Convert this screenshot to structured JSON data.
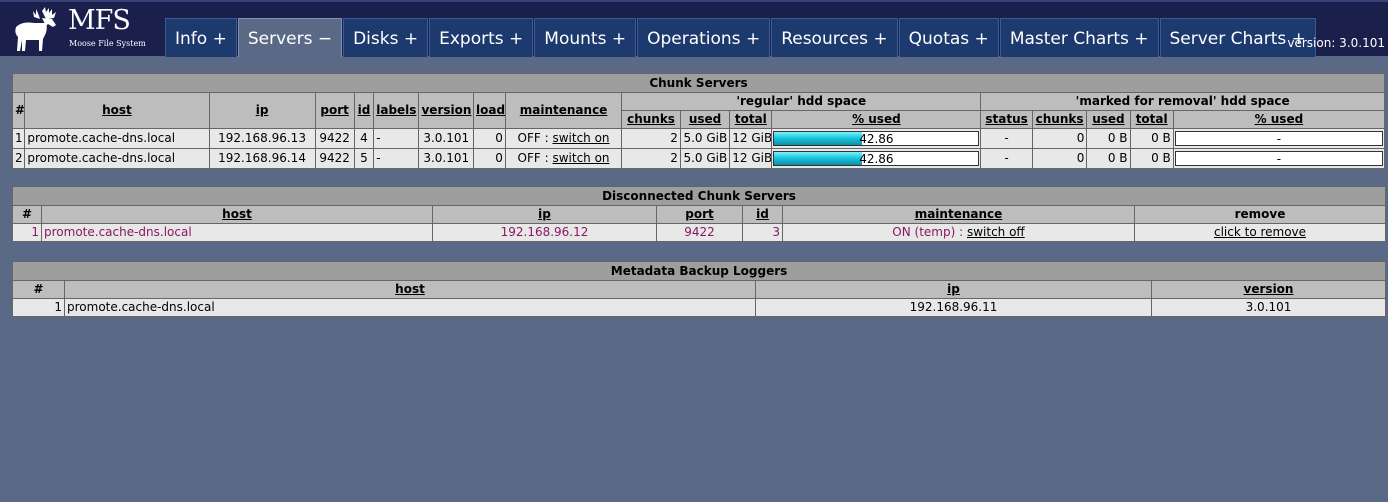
{
  "header": {
    "logo_title": "MFS",
    "logo_subtitle": "Moose File System",
    "version": "version: 3.0.101",
    "tabs": [
      {
        "label": "Info +"
      },
      {
        "label": "Servers −"
      },
      {
        "label": "Disks +"
      },
      {
        "label": "Exports +"
      },
      {
        "label": "Mounts +"
      },
      {
        "label": "Operations +"
      },
      {
        "label": "Resources +"
      },
      {
        "label": "Quotas +"
      },
      {
        "label": "Master Charts +"
      },
      {
        "label": "Server Charts +"
      }
    ],
    "active_tab": "Servers"
  },
  "chunk_servers": {
    "title": "Chunk Servers",
    "headers": {
      "num": "#",
      "host": "host",
      "ip": "ip",
      "port": "port",
      "id": "id",
      "labels": "labels",
      "version": "version",
      "load": "load",
      "maintenance": "maintenance",
      "regular": "'regular' hdd space",
      "marked": "'marked for removal' hdd space",
      "chunks": "chunks",
      "used": "used",
      "total": "total",
      "pct_used": "% used",
      "status": "status"
    },
    "rows": [
      {
        "num": "1",
        "host": "promote.cache-dns.local",
        "ip": "192.168.96.13",
        "port": "9422",
        "id": "4",
        "labels": "-",
        "version": "3.0.101",
        "load": "0",
        "maint_state": "OFF : ",
        "maint_link": "switch on",
        "chunks": "2",
        "used": "5.0 GiB",
        "total": "12 GiB",
        "pct": "42.86",
        "pct_value": 42.86,
        "m_status": "-",
        "m_chunks": "0",
        "m_used": "0 B",
        "m_total": "0 B",
        "m_pct": "-"
      },
      {
        "num": "2",
        "host": "promote.cache-dns.local",
        "ip": "192.168.96.14",
        "port": "9422",
        "id": "5",
        "labels": "-",
        "version": "3.0.101",
        "load": "0",
        "maint_state": "OFF : ",
        "maint_link": "switch on",
        "chunks": "2",
        "used": "5.0 GiB",
        "total": "12 GiB",
        "pct": "42.86",
        "pct_value": 42.86,
        "m_status": "-",
        "m_chunks": "0",
        "m_used": "0 B",
        "m_total": "0 B",
        "m_pct": "-"
      }
    ]
  },
  "disconnected": {
    "title": "Disconnected Chunk Servers",
    "headers": {
      "num": "#",
      "host": "host",
      "ip": "ip",
      "port": "port",
      "id": "id",
      "maintenance": "maintenance",
      "remove": "remove"
    },
    "rows": [
      {
        "num": "1",
        "host": "promote.cache-dns.local",
        "ip": "192.168.96.12",
        "port": "9422",
        "id": "3",
        "maint_state": "ON (temp) : ",
        "maint_link": "switch off",
        "remove": "click to remove"
      }
    ]
  },
  "loggers": {
    "title": "Metadata Backup Loggers",
    "headers": {
      "num": "#",
      "host": "host",
      "ip": "ip",
      "version": "version"
    },
    "rows": [
      {
        "num": "1",
        "host": "promote.cache-dns.local",
        "ip": "192.168.96.11",
        "version": "3.0.101"
      }
    ]
  },
  "colors": {
    "header_bg": "#1b1f4b",
    "page_bg": "#5a6a86",
    "tab_bg": "#1d3a6e",
    "bar_fill": "#1bc6dc",
    "disconnected_text": "#8a1860"
  }
}
